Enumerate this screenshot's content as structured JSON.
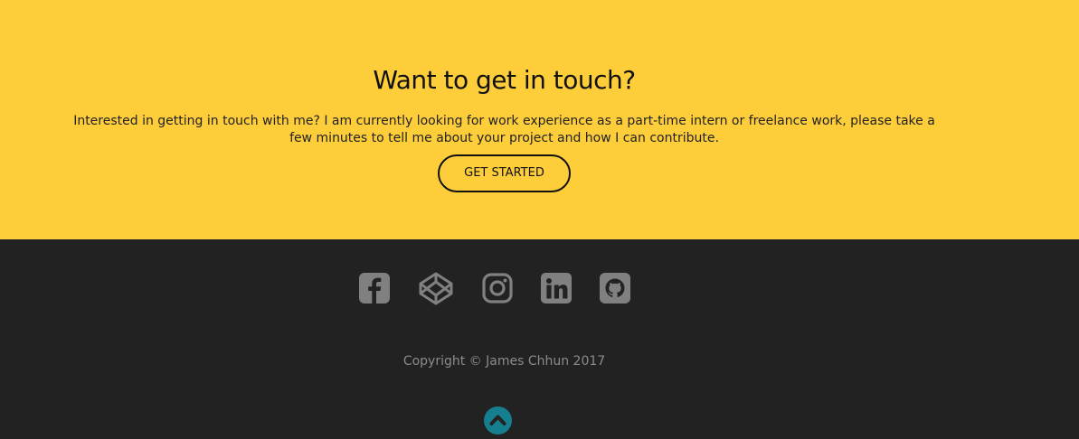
{
  "contact": {
    "title": "Want to get in touch?",
    "text": "Interested in getting in touch with me? I am currently looking for work experience as a part-time intern or freelance work, please take a few minutes to tell me about your project and how I can contribute.",
    "button_label": "GET STARTED"
  },
  "footer": {
    "social_icons": [
      "facebook-icon",
      "codepen-icon",
      "instagram-icon",
      "linkedin-icon",
      "github-icon"
    ],
    "copyright": "Copyright © James Chhun 2017",
    "back_to_top_icon": "chevron-up-icon"
  },
  "colors": {
    "accent_yellow": "#fecd3a",
    "footer_bg": "#222222",
    "icon_gray": "#808080",
    "back_to_top": "#167f8f"
  }
}
